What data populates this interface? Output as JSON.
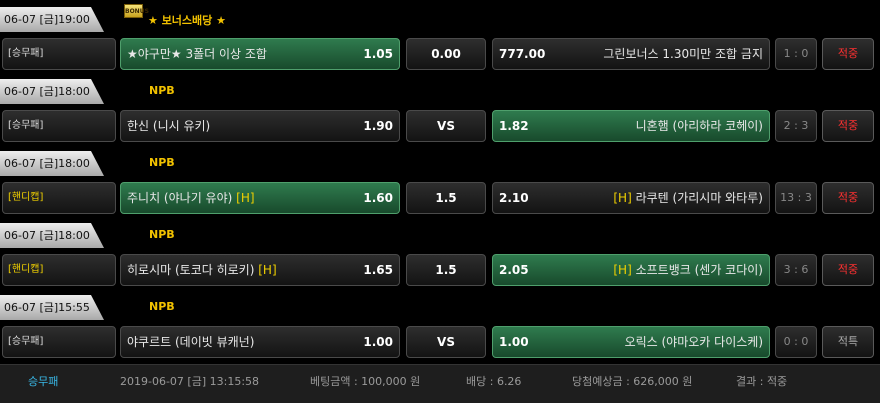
{
  "bonus": {
    "badge": "BONUS",
    "title": "★ 보너스배당 ★"
  },
  "rows": [
    {
      "date": "06-07 [금]19:00",
      "type": "[승무패]",
      "home": "★야구만★ 3폴더 이상 조합",
      "home_odd": "1.05",
      "mid": "0.00",
      "away_odd": "777.00",
      "away": "그린보너스 1.30미만 조합 금지",
      "score": "1 : 0",
      "result": "적중"
    },
    {
      "date": "06-07 [금]18:00",
      "league": "NPB",
      "type": "[승무패]",
      "home": "한신 (니시 유키)",
      "home_odd": "1.90",
      "mid": "VS",
      "away_odd": "1.82",
      "away": "니혼햄 (아리하라 코헤이)",
      "score": "2 : 3",
      "result": "적중"
    },
    {
      "date": "06-07 [금]18:00",
      "league": "NPB",
      "type": "[핸디캡]",
      "home": "주니치 (야나기 유야)",
      "home_tag": "[H]",
      "home_odd": "1.60",
      "mid": "1.5",
      "away_odd": "2.10",
      "away_tag": "[H]",
      "away": "라쿠텐 (가리시마 와타루)",
      "score": "13 : 3",
      "result": "적중"
    },
    {
      "date": "06-07 [금]18:00",
      "league": "NPB",
      "type": "[핸디캡]",
      "home": "히로시마 (토코다 히로키)",
      "home_tag": "[H]",
      "home_odd": "1.65",
      "mid": "1.5",
      "away_odd": "2.05",
      "away_tag": "[H]",
      "away": "소프트뱅크 (센가 코다이)",
      "score": "3 : 6",
      "result": "적중"
    },
    {
      "date": "06-07 [금]15:55",
      "league": "NPB",
      "type": "[승무패]",
      "home": "야쿠르트 (데이빗 뷰캐넌)",
      "home_odd": "1.00",
      "mid": "VS",
      "away_odd": "1.00",
      "away": "오릭스 (야마오카 다이스케)",
      "score": "0 : 0",
      "result": "적특"
    }
  ],
  "footer": {
    "type": "승무패",
    "datetime": "2019-06-07 [금] 13:15:58",
    "bet_amount": "베팅금액 : 100,000 원",
    "odds": "배당 : 6.26",
    "expected": "당첨예상금 : 626,000 원",
    "result": "결과 : 적중"
  },
  "colors": {
    "selected": "#2f7b4e",
    "hit": "#ff3030",
    "league": "#f2c200",
    "handicap": "#f0d000",
    "footer_type": "#39b9e8"
  }
}
